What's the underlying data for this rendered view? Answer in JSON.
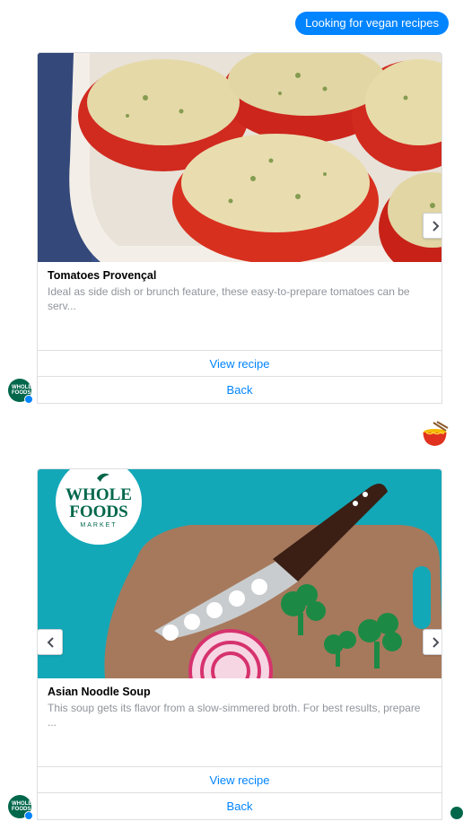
{
  "user_message": "Looking for vegan recipes",
  "brand_avatar_text": "WHOLE FOODS",
  "emoji_reaction": "noodle-bowl-emoji",
  "cards": [
    {
      "title": "Tomatoes Provençal",
      "subtitle": "Ideal as side dish or brunch feature, these easy-to-prepare tomatoes can be serv...",
      "buttons": [
        "View recipe",
        "Back"
      ],
      "image": "stuffed-tomatoes-photo"
    },
    {
      "title": "Asian Noodle Soup",
      "subtitle": "This soup gets its flavor from a slow-simmered broth. For best results, prepare ...",
      "buttons": [
        "View recipe",
        "Back"
      ],
      "image": "whole-foods-knife-board-illustration",
      "logo_line1": "WHOLE",
      "logo_line2": "FOODS",
      "logo_line3": "MARKET"
    }
  ],
  "colors": {
    "accent": "#0084ff",
    "brand_green": "#00674b",
    "teal_bg": "#13a8b8",
    "board_brown": "#a6795c"
  }
}
